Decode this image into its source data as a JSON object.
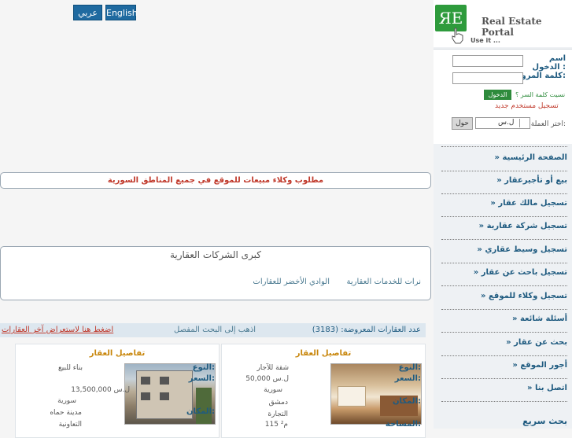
{
  "lang": {
    "arabic": "عربي",
    "english": "English"
  },
  "banner": {
    "agents": "مطلوب وكلاء مبيعات للموقع في جميع المناطق السورية"
  },
  "companies": {
    "title": "كبرى الشركات العقارية",
    "items": [
      "نرات للخدمات العقارية",
      "الوادي الأخضر للعقارات"
    ]
  },
  "stats": {
    "count_label": "عدد العقارات المعروضة: (3183)",
    "advanced_search": "اذهب إلى البحث المفصل",
    "latest": "اضغط هنا لاستعراض آخر العقارات"
  },
  "cards": [
    {
      "title": "تفاصيل العقار",
      "type_label": "النوع:",
      "type": "شقة للآجار",
      "price_label": "السعر:",
      "price": "50,000 ل.س",
      "country": "سورية",
      "place_label": "المكان:",
      "place": "دمشق التجارة",
      "area_label": "المساحة:",
      "area": "115 م²"
    },
    {
      "title": "تفاصيل العقار",
      "type_label": "النوع:",
      "type": "بناء للبيع",
      "price_label": "السعر:",
      "price": "13,500,000 ل.س",
      "country": "سورية",
      "place_label": "المكان:",
      "place": "مدينة حماه التعاونية"
    }
  ],
  "logo": {
    "mark": "ЯE",
    "name": "Real Estate Portal",
    "tagline": "Use it ..."
  },
  "login": {
    "username_label": "اسم الدخول :",
    "password_label": "كلمة المرور:",
    "button": "الدخول",
    "forgot": "نسيت كلمة السر ؟",
    "register": "تسجيل مستخدم جديد"
  },
  "currency": {
    "label": "اختر العملة:",
    "value": "ل.س",
    "convert": "حول"
  },
  "nav": [
    "» الصفحة الرئيسية",
    "» بيع أو تأجيرعقار",
    "» تسجيل مالك عقار",
    "» تسجيل شركة عقارية",
    "» تسجيل وسيط عقاري",
    "» تسجيل باحث عن عقار",
    "» تسجيل وكلاء للموقع",
    "» أسئلة شائعة",
    "» بحث عن عقار",
    "» أجور الموقع",
    "» اتصل بنا"
  ],
  "quick_search": "بحث سريع",
  "colors": {
    "accent_green": "#2e9b3c",
    "link_blue": "#1f5b80",
    "alert_red": "#c0392b",
    "lang_blue": "#1f6aa0"
  }
}
